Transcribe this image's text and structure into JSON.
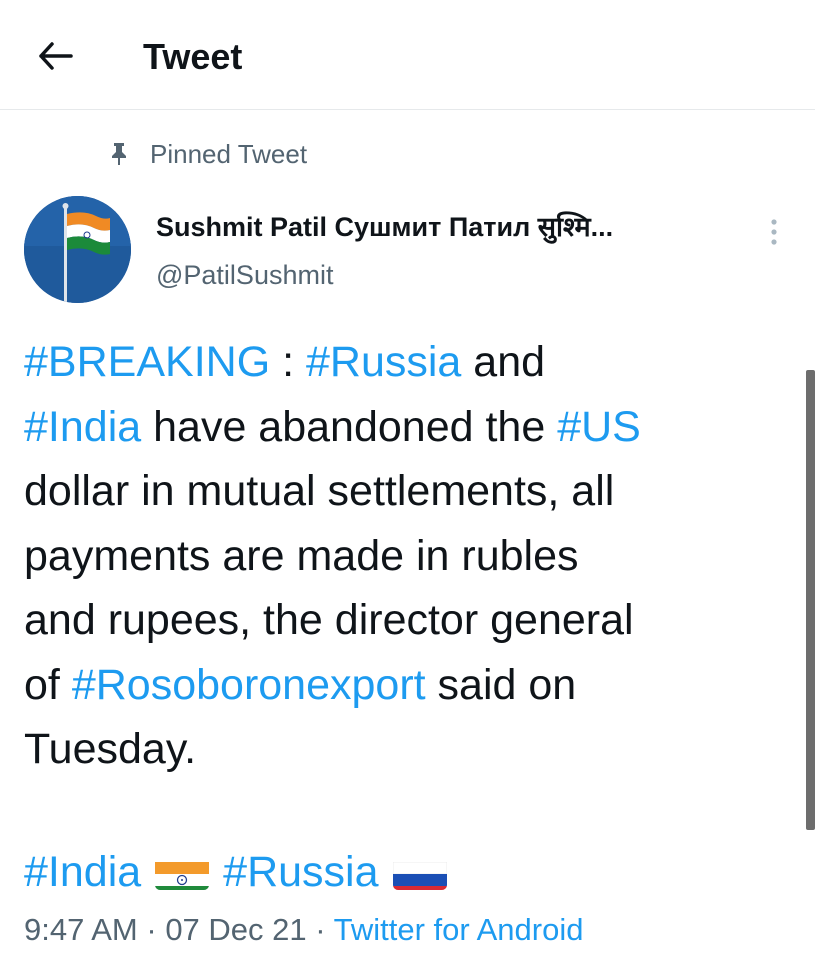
{
  "header": {
    "title": "Tweet",
    "back_icon": "arrow-left-icon"
  },
  "pinned": {
    "label": "Pinned Tweet",
    "icon": "pin-icon"
  },
  "author": {
    "name": "Sushmit Patil Сушмит Патил सुश्मि...",
    "handle": "@PatilSushmit",
    "avatar": "flag-on-pole-avatar"
  },
  "tweet": {
    "lines": [
      [
        {
          "t": "#BREAKING",
          "tag": true
        },
        {
          "t": " : "
        },
        {
          "t": "#Russia",
          "tag": true
        },
        {
          "t": " and"
        }
      ],
      [
        {
          "t": "#India",
          "tag": true
        },
        {
          "t": " have abandoned the "
        },
        {
          "t": "#US",
          "tag": true
        }
      ],
      [
        {
          "t": "dollar in mutual settlements, all"
        }
      ],
      [
        {
          "t": "payments are made in rubles"
        }
      ],
      [
        {
          "t": "and rupees, the director general"
        }
      ],
      [
        {
          "t": "of "
        },
        {
          "t": "#Rosoboronexport",
          "tag": true
        },
        {
          "t": " said on"
        }
      ],
      [
        {
          "t": "Tuesday."
        }
      ]
    ],
    "hashtag_india": "#India",
    "hashtag_russia": "#Russia"
  },
  "meta": {
    "time": "9:47 AM",
    "separator": " · ",
    "date": "07 Dec 21",
    "source": "Twitter for Android"
  },
  "colors": {
    "link": "#1d9bf0",
    "secondary_text": "#536471",
    "primary_text": "#0f1419"
  }
}
